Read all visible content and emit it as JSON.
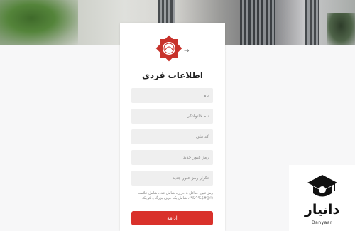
{
  "form": {
    "title": "اطلاعات فردی",
    "fields": [
      {
        "placeholder": "نام"
      },
      {
        "placeholder": "نام خانوادگی"
      },
      {
        "placeholder": "کد ملی"
      },
      {
        "placeholder": "رمز عبور جدید"
      },
      {
        "placeholder": "تکرار رمز عبور جدید"
      }
    ],
    "password_hint": "رمز عبور حداقل ۸ حرف، شامل عدد، شامل علامت (!@#$%^&*)، شامل یک حرف بزرگ و کوچک",
    "continue_label": "ادامه"
  },
  "watermark": {
    "text": "دانیار",
    "subtext": "Danyaar"
  },
  "colors": {
    "accent": "#d9312b",
    "logo_red": "#c8322b",
    "field_bg": "#efefef"
  },
  "icons": {
    "logo": "star-seal-logo",
    "back": "arrow-right-icon",
    "watermark": "graduation-cap-icon"
  }
}
